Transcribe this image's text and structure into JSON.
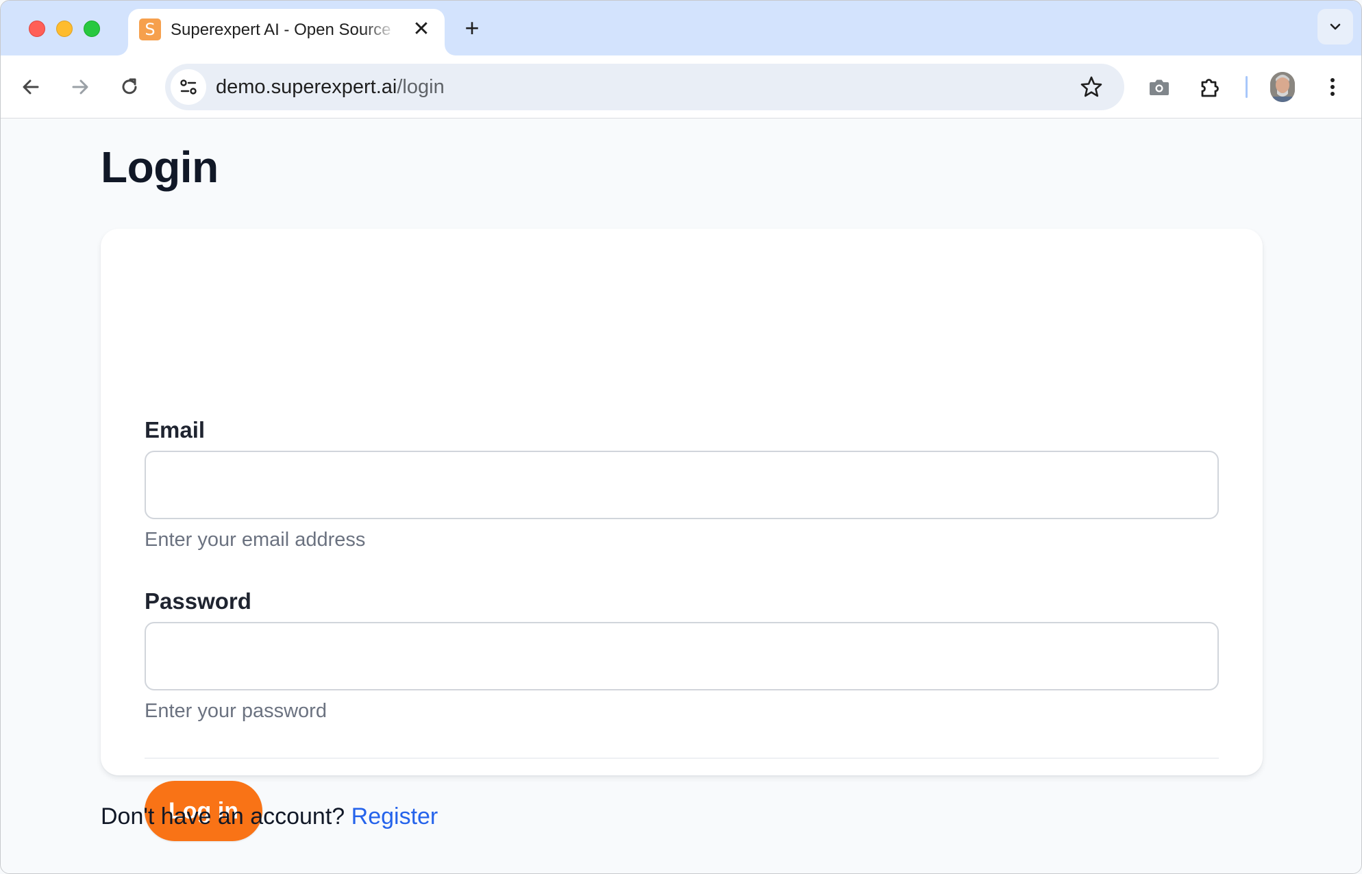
{
  "browser": {
    "tab_title": "Superexpert AI - Open Source",
    "favicon_letter": "S",
    "close_glyph": "✕",
    "new_tab_glyph": "+",
    "url_host": "demo.superexpert.ai",
    "url_path": "/login"
  },
  "page": {
    "title": "Login",
    "email": {
      "label": "Email",
      "value": "",
      "help": "Enter your email address"
    },
    "password": {
      "label": "Password",
      "value": "",
      "help": "Enter your password"
    },
    "submit_label": "Log in",
    "register_prompt": "Don't have an account?",
    "register_link": "Register"
  },
  "colors": {
    "accent": "#f97316",
    "link": "#2563eb",
    "tabbar": "#d3e3fd"
  }
}
